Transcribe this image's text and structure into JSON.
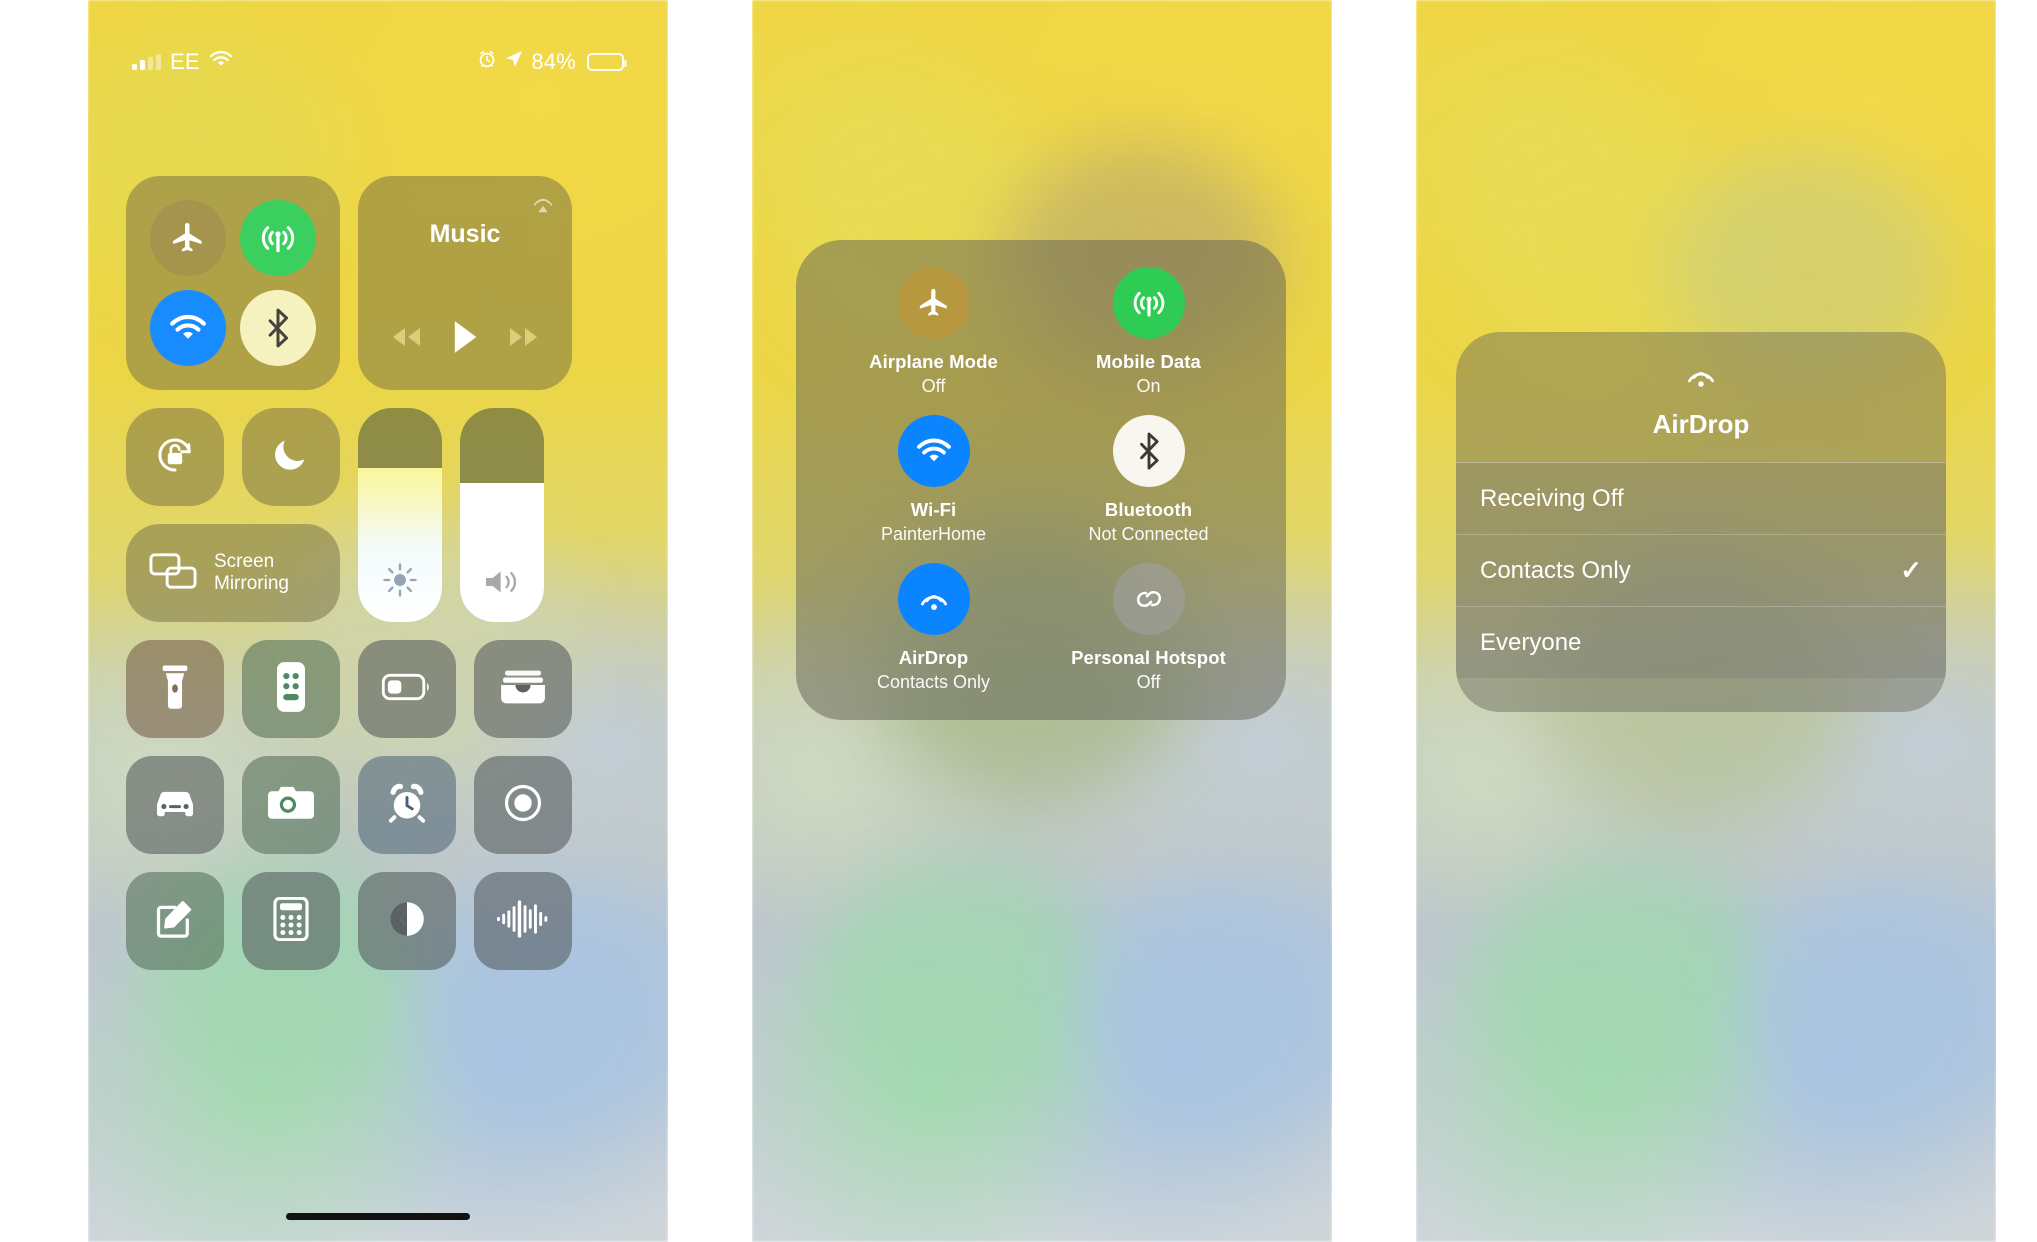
{
  "status_bar": {
    "carrier": "EE",
    "signal_icon": "cellular-bars-icon",
    "wifi_icon": "wifi-icon",
    "alarm_icon": "alarm-clock-icon",
    "location_icon": "location-arrow-icon",
    "battery_percent": "84%",
    "battery_level": 84,
    "battery_icon": "battery-icon"
  },
  "panel1": {
    "connectivity": {
      "airplane": {
        "name": "airplane-mode-toggle",
        "icon": "airplane-icon",
        "state": "off"
      },
      "cellular": {
        "name": "mobile-data-toggle",
        "icon": "cellular-antenna-icon",
        "state": "on"
      },
      "wifi": {
        "name": "wifi-toggle",
        "icon": "wifi-icon",
        "state": "on"
      },
      "bluetooth": {
        "name": "bluetooth-toggle",
        "icon": "bluetooth-icon",
        "state": "on"
      }
    },
    "music": {
      "title": "Music",
      "airplay_icon": "airplay-audio-icon",
      "rewind_icon": "rewind-icon",
      "play_icon": "play-icon",
      "forward_icon": "fast-forward-icon"
    },
    "rotation_lock": {
      "label": "rotation-lock",
      "icon": "rotation-lock-icon"
    },
    "do_not_disturb": {
      "label": "do-not-disturb",
      "icon": "moon-icon"
    },
    "screen_mirroring": {
      "line1": "Screen",
      "line2": "Mirroring",
      "icon": "screen-mirroring-icon"
    },
    "brightness": {
      "icon": "brightness-icon",
      "value": 72
    },
    "volume": {
      "icon": "volume-icon",
      "value": 65
    },
    "apps": [
      {
        "name": "flashlight",
        "icon": "flashlight-icon",
        "tone": "warm"
      },
      {
        "name": "apple-tv-remote",
        "icon": "remote-icon",
        "tone": "green"
      },
      {
        "name": "low-power-mode",
        "icon": "battery-icon",
        "tone": "plain"
      },
      {
        "name": "wallet",
        "icon": "wallet-icon",
        "tone": "plain"
      },
      {
        "name": "car-mode",
        "icon": "car-icon",
        "tone": "plain"
      },
      {
        "name": "camera",
        "icon": "camera-icon",
        "tone": "green"
      },
      {
        "name": "alarm",
        "icon": "alarm-clock-icon",
        "tone": "blueish"
      },
      {
        "name": "screen-recording",
        "icon": "record-icon",
        "tone": "plain"
      },
      {
        "name": "notes",
        "icon": "notes-pencil-icon",
        "tone": "green"
      },
      {
        "name": "calculator",
        "icon": "calculator-icon",
        "tone": "plain"
      },
      {
        "name": "dark-mode",
        "icon": "contrast-circle-icon",
        "tone": "plain"
      },
      {
        "name": "voice-memos",
        "icon": "waveform-icon",
        "tone": "plain"
      }
    ]
  },
  "panel2": {
    "expanded_module": [
      {
        "title": "Airplane Mode",
        "subtitle": "Off",
        "icon": "airplane-icon",
        "style": "airplane"
      },
      {
        "title": "Mobile Data",
        "subtitle": "On",
        "icon": "cellular-antenna-icon",
        "style": "green"
      },
      {
        "title": "Wi-Fi",
        "subtitle": "PainterHome",
        "icon": "wifi-icon",
        "style": "blue"
      },
      {
        "title": "Bluetooth",
        "subtitle": "Not Connected",
        "icon": "bluetooth-icon",
        "style": "cream"
      },
      {
        "title": "AirDrop",
        "subtitle": "Contacts Only",
        "icon": "airdrop-icon",
        "style": "blue"
      },
      {
        "title": "Personal Hotspot",
        "subtitle": "Off",
        "icon": "hotspot-link-icon",
        "style": "grey"
      }
    ]
  },
  "panel3": {
    "airdrop_menu": {
      "icon": "airdrop-icon",
      "title": "AirDrop",
      "options": [
        {
          "label": "Receiving Off",
          "selected": false
        },
        {
          "label": "Contacts Only",
          "selected": true
        },
        {
          "label": "Everyone",
          "selected": false
        }
      ],
      "check_glyph": "✓"
    }
  },
  "colors": {
    "accent_blue": "#0a84ff",
    "accent_green": "#2fcc55",
    "cream": "#f6f2bd",
    "wallpaper_yellow": "#efd644",
    "wallpaper_grey": "#c5cdd4"
  }
}
